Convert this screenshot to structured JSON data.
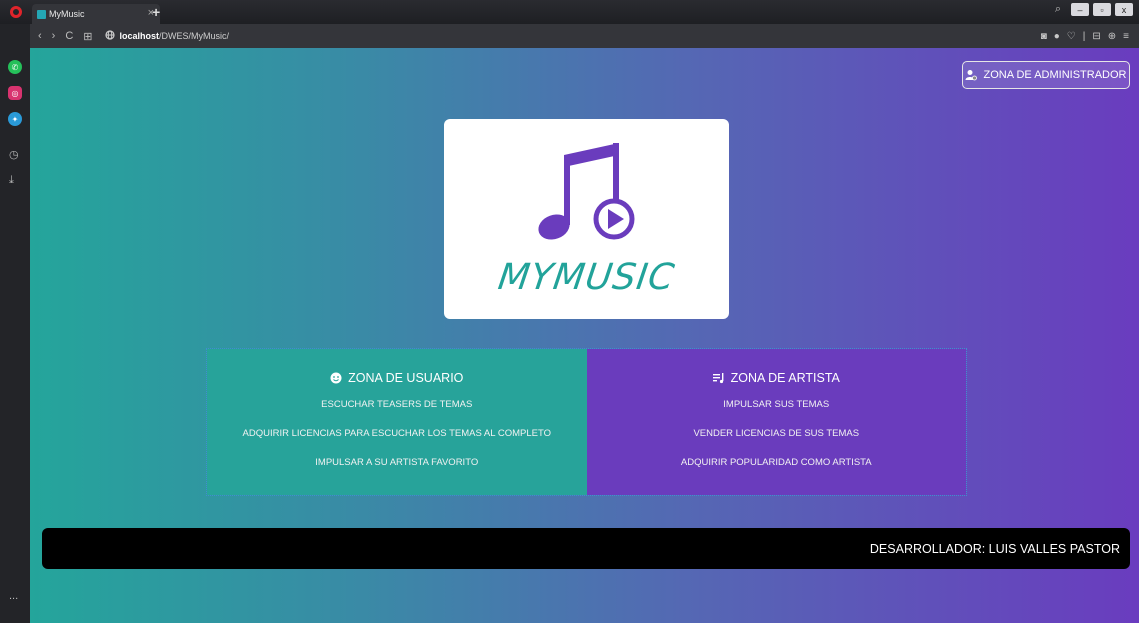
{
  "browser": {
    "tab_title": "MyMusic",
    "tab_close": "×",
    "new_tab": "+",
    "url_host": "localhost",
    "url_path": "/DWES/MyMusic/",
    "search_glyph": "⌕",
    "window_buttons": [
      "–",
      "▫",
      "x"
    ],
    "nav_icons": [
      "‹",
      "›",
      "C",
      "⊞"
    ],
    "right_icons": [
      "◙",
      "●",
      "♡",
      "|",
      "⊟",
      "⊕",
      "≡"
    ],
    "sidebar_more": "..."
  },
  "admin": {
    "label": "ZONA DE ADMINISTRADOR",
    "icon": "user-gear-icon"
  },
  "logo": {
    "text": "MYMUSIC",
    "note_color": "#6a3cbd",
    "text_color": "#22a39a"
  },
  "zones": {
    "user": {
      "title": "ZONA DE USUARIO",
      "icon": "smiley-icon",
      "items": [
        "ESCUCHAR TEASERS DE TEMAS",
        "ADQUIRIR LICENCIAS PARA ESCUCHAR LOS TEMAS AL COMPLETO",
        "IMPULSAR A SU ARTISTA FAVORITO"
      ]
    },
    "artist": {
      "title": "ZONA DE ARTISTA",
      "icon": "playlist-icon",
      "items": [
        "IMPULSAR SUS TEMAS",
        "VENDER LICENCIAS DE SUS TEMAS",
        "ADQUIRIR POPULARIDAD COMO ARTISTA"
      ]
    }
  },
  "footer": {
    "developer": "DESARROLLADOR: LUIS VALLES PASTOR"
  },
  "colors": {
    "teal": "#27a39a",
    "purple": "#6a3cbd",
    "footer": "#000000"
  }
}
